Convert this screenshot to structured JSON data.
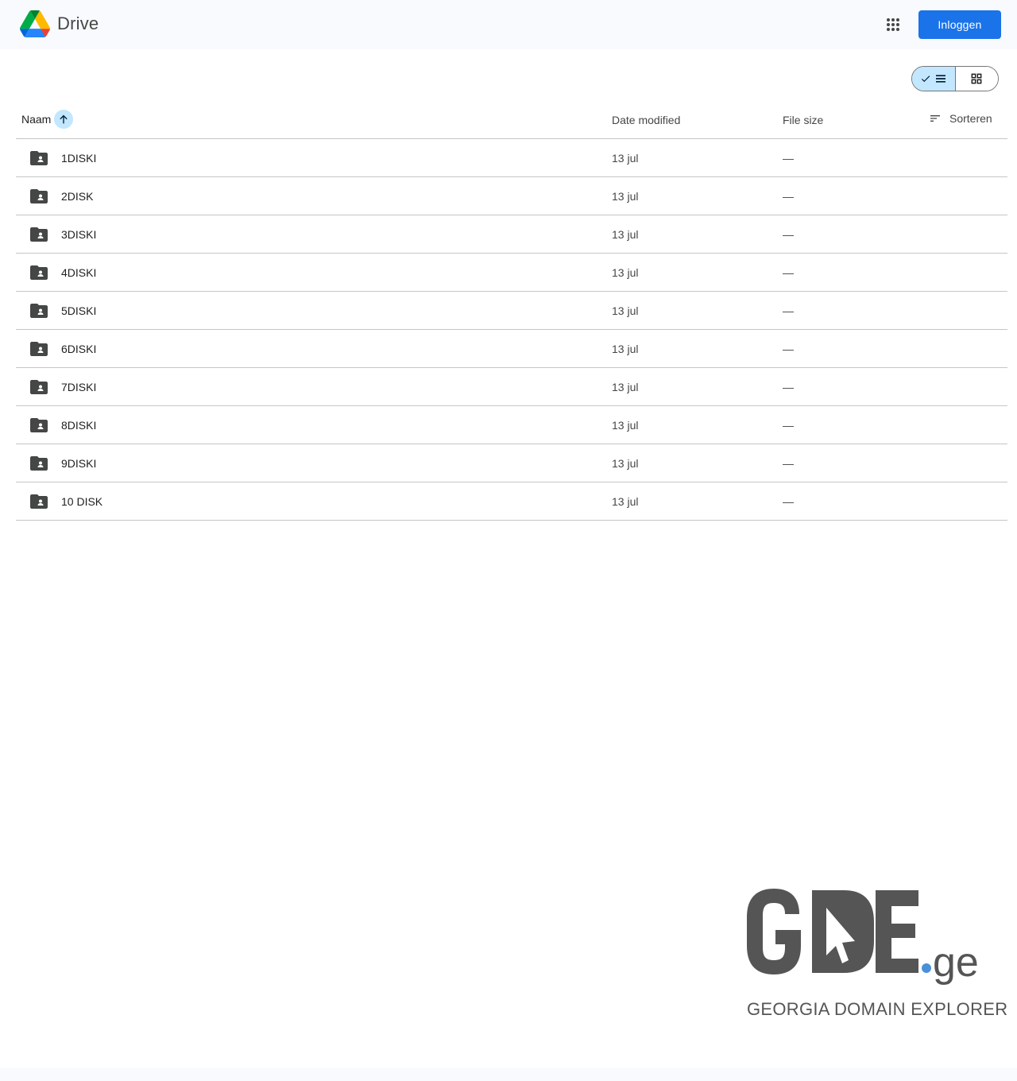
{
  "header": {
    "app_name": "Drive",
    "login_label": "Inloggen",
    "logo_icon": "google-drive-logo",
    "apps_icon": "apps-grid-icon"
  },
  "toolbar": {
    "view_list_icon": "list-view-icon",
    "view_grid_icon": "grid-view-icon",
    "selected_view": "list"
  },
  "table": {
    "columns": {
      "name": "Naam",
      "date": "Date modified",
      "size": "File size",
      "sort": "Sorteren"
    },
    "rows": [
      {
        "name": "1DISKI",
        "date": "13 jul",
        "size": "—"
      },
      {
        "name": "2DISK",
        "date": "13 jul",
        "size": "—"
      },
      {
        "name": "3DISKI",
        "date": "13 jul",
        "size": "—"
      },
      {
        "name": "4DISKI",
        "date": "13 jul",
        "size": "—"
      },
      {
        "name": "5DISKI",
        "date": "13 jul",
        "size": "—"
      },
      {
        "name": "6DISKI",
        "date": "13 jul",
        "size": "—"
      },
      {
        "name": "7DISKI",
        "date": "13 jul",
        "size": "—"
      },
      {
        "name": "8DISKI",
        "date": "13 jul",
        "size": "—"
      },
      {
        "name": "9DISKI",
        "date": "13 jul",
        "size": "—"
      },
      {
        "name": "10 DISK",
        "date": "13 jul",
        "size": "—"
      }
    ]
  },
  "watermark": {
    "brand": "GDE.ge",
    "tagline": "GEORGIA DOMAIN EXPLORER"
  },
  "colors": {
    "accent": "#1a73e8",
    "selected": "#c2e7ff",
    "divider": "#c4c7c5",
    "background": "#f8fafd"
  }
}
